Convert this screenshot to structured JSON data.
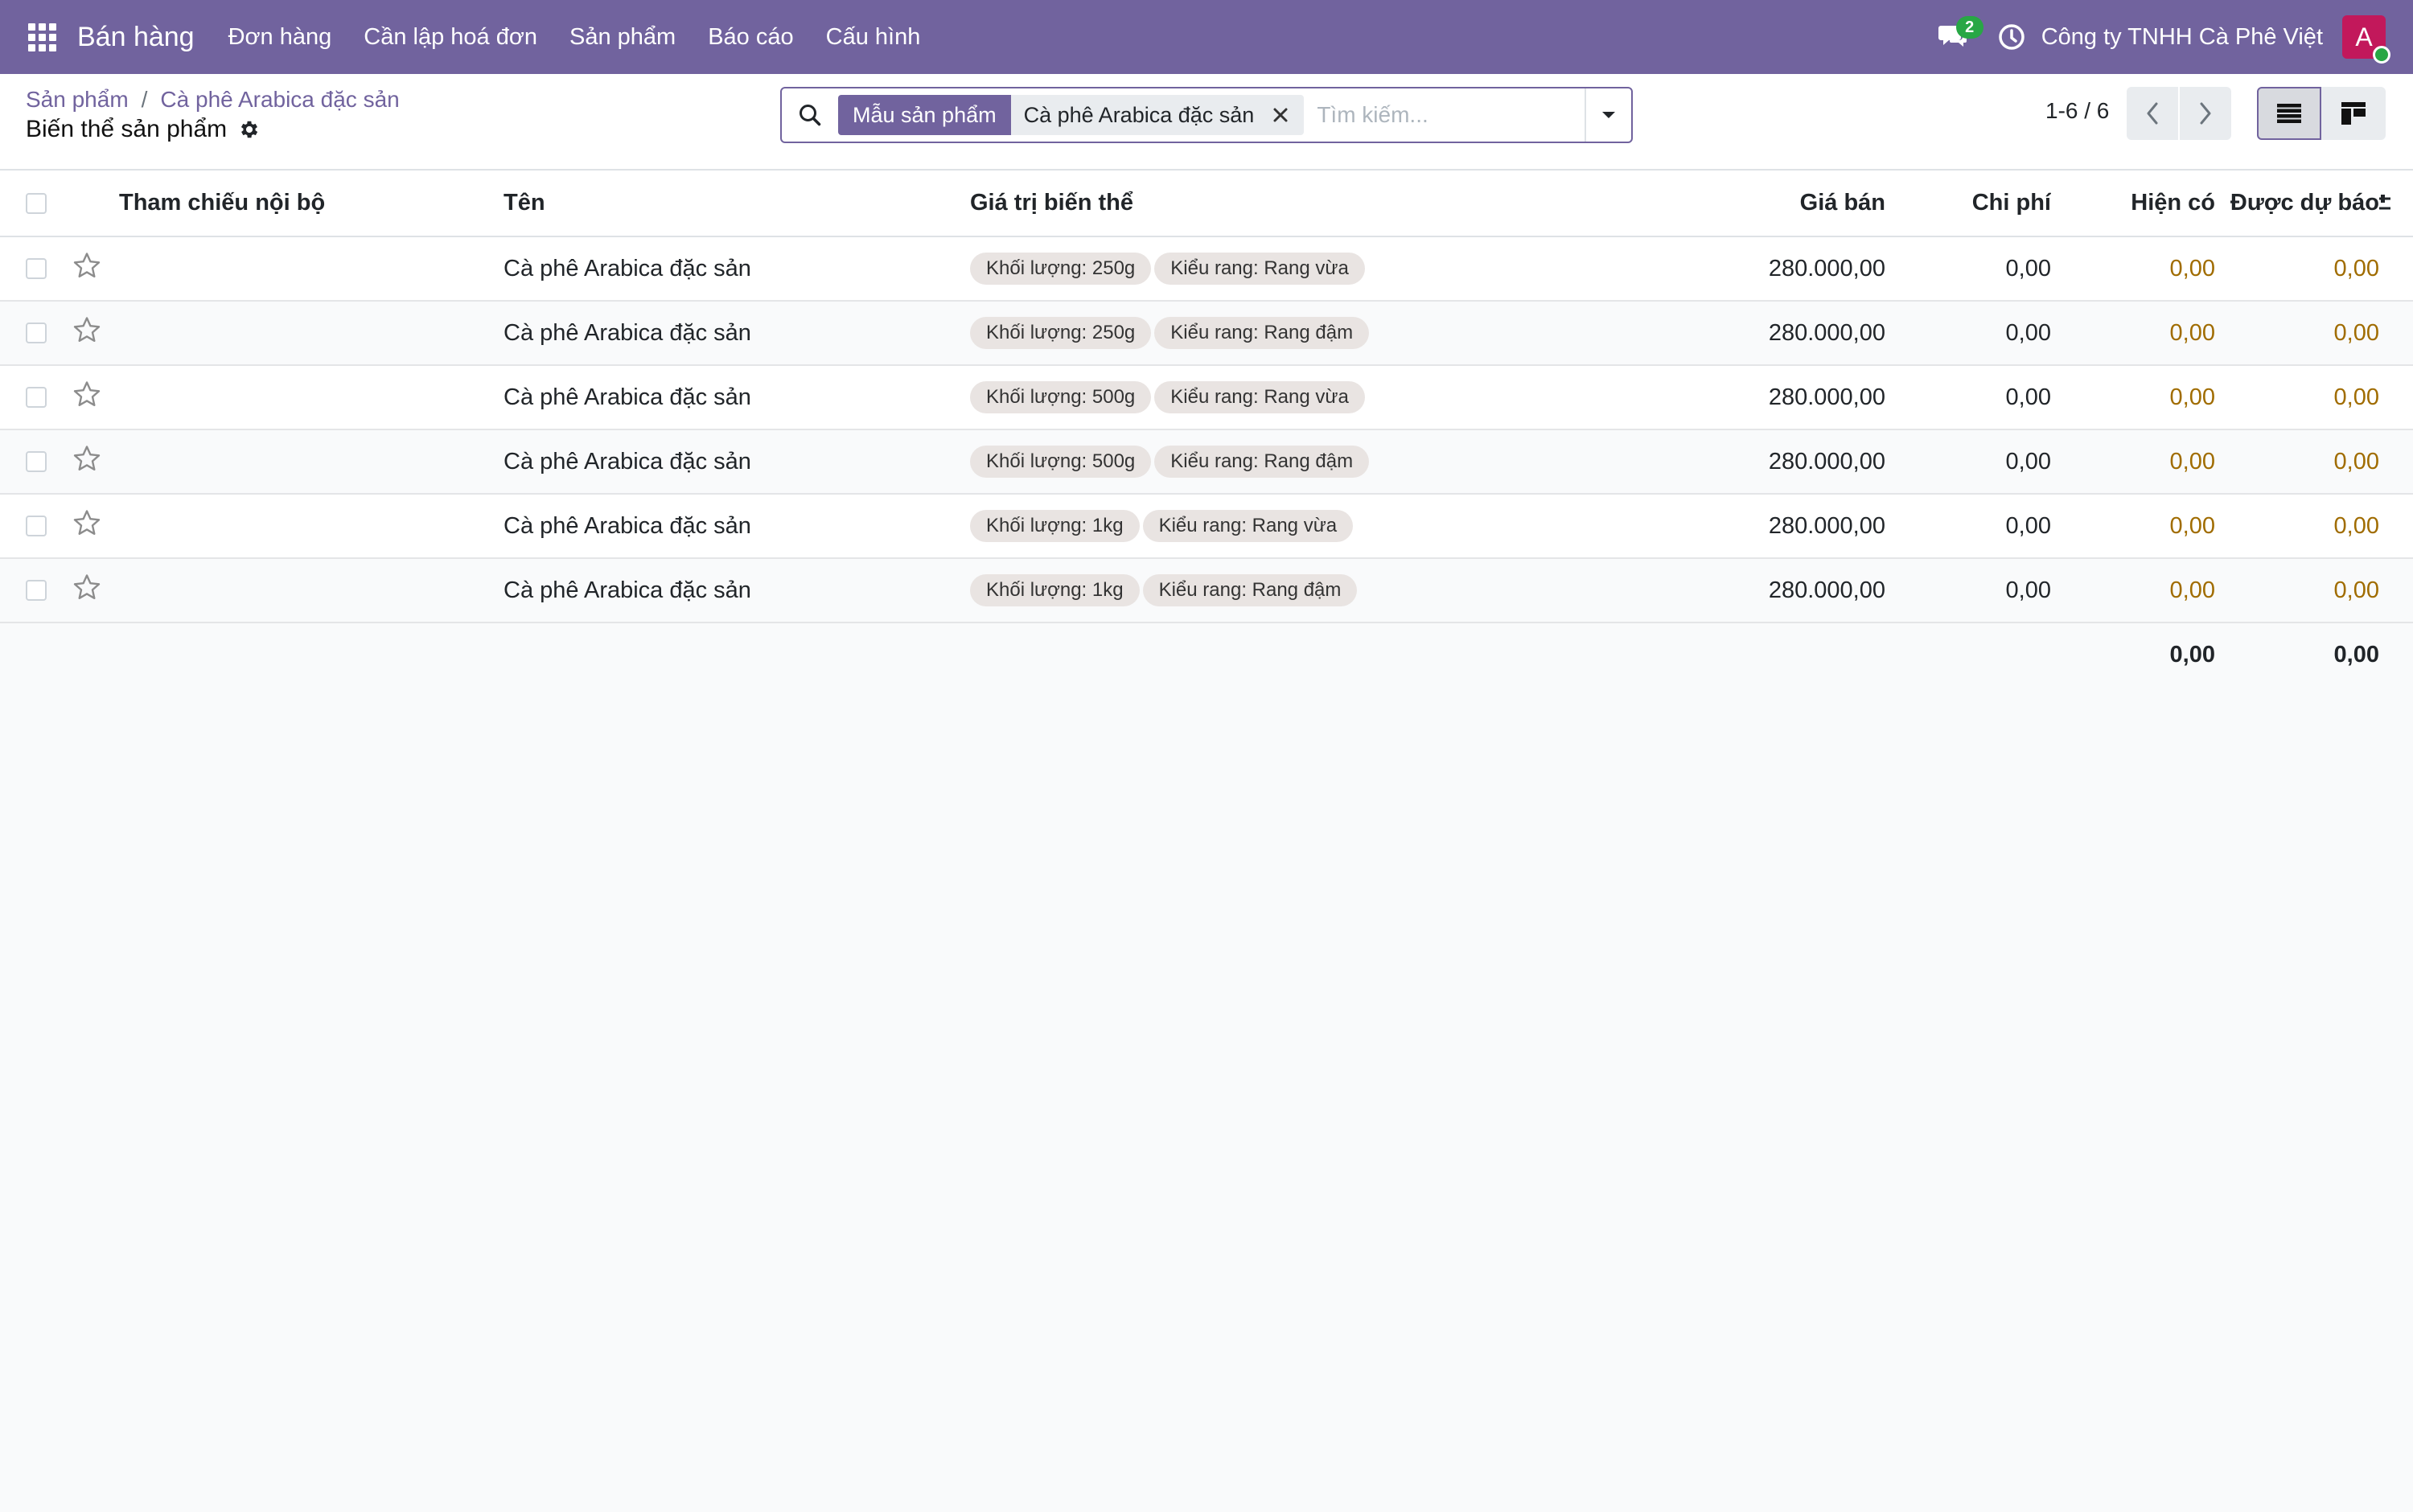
{
  "navbar": {
    "app_name": "Bán hàng",
    "menu": [
      "Đơn hàng",
      "Cần lập hoá đơn",
      "Sản phẩm",
      "Báo cáo",
      "Cấu hình"
    ],
    "chat_count": "2",
    "company": "Công ty TNHH Cà Phê Việt",
    "avatar_letter": "A",
    "colors": {
      "brand": "#71639e",
      "online": "#28a745",
      "avatar": "#c2185b"
    }
  },
  "breadcrumb": {
    "parent": "Sản phẩm",
    "current": "Cà phê Arabica đặc sản"
  },
  "page_title": "Biến thể sản phẩm",
  "search": {
    "facet_label": "Mẫu sản phẩm",
    "facet_value": "Cà phê Arabica đặc sản",
    "placeholder": "Tìm kiếm..."
  },
  "pager": {
    "value": "1-6 / 6"
  },
  "table": {
    "columns": {
      "ref": "Tham chiếu nội bộ",
      "name": "Tên",
      "attributes": "Giá trị biến thể",
      "price": "Giá bán",
      "cost": "Chi phí",
      "on_hand": "Hiện có",
      "forecast": "Được dự báo"
    },
    "rows": [
      {
        "ref": "",
        "name": "Cà phê Arabica đặc sản",
        "tags": [
          "Khối lượng: 250g",
          "Kiểu rang: Rang vừa"
        ],
        "price": "280.000,00",
        "cost": "0,00",
        "on_hand": "0,00",
        "forecast": "0,00"
      },
      {
        "ref": "",
        "name": "Cà phê Arabica đặc sản",
        "tags": [
          "Khối lượng: 250g",
          "Kiểu rang: Rang đậm"
        ],
        "price": "280.000,00",
        "cost": "0,00",
        "on_hand": "0,00",
        "forecast": "0,00"
      },
      {
        "ref": "",
        "name": "Cà phê Arabica đặc sản",
        "tags": [
          "Khối lượng: 500g",
          "Kiểu rang: Rang vừa"
        ],
        "price": "280.000,00",
        "cost": "0,00",
        "on_hand": "0,00",
        "forecast": "0,00"
      },
      {
        "ref": "",
        "name": "Cà phê Arabica đặc sản",
        "tags": [
          "Khối lượng: 500g",
          "Kiểu rang: Rang đậm"
        ],
        "price": "280.000,00",
        "cost": "0,00",
        "on_hand": "0,00",
        "forecast": "0,00"
      },
      {
        "ref": "",
        "name": "Cà phê Arabica đặc sản",
        "tags": [
          "Khối lượng: 1kg",
          "Kiểu rang: Rang vừa"
        ],
        "price": "280.000,00",
        "cost": "0,00",
        "on_hand": "0,00",
        "forecast": "0,00"
      },
      {
        "ref": "",
        "name": "Cà phê Arabica đặc sản",
        "tags": [
          "Khối lượng: 1kg",
          "Kiểu rang: Rang đậm"
        ],
        "price": "280.000,00",
        "cost": "0,00",
        "on_hand": "0,00",
        "forecast": "0,00"
      }
    ],
    "totals": {
      "on_hand": "0,00",
      "forecast": "0,00"
    },
    "colors": {
      "quantity_warning": "#a06c00",
      "tag_bg": "#e9e4e2"
    }
  },
  "icons": [
    "apps-icon",
    "chat-icon",
    "clock-icon",
    "gear-icon",
    "search-icon",
    "close-icon",
    "caret-down-icon",
    "chevron-left-icon",
    "chevron-right-icon",
    "list-view-icon",
    "kanban-view-icon",
    "star-icon",
    "optional-columns-icon"
  ]
}
